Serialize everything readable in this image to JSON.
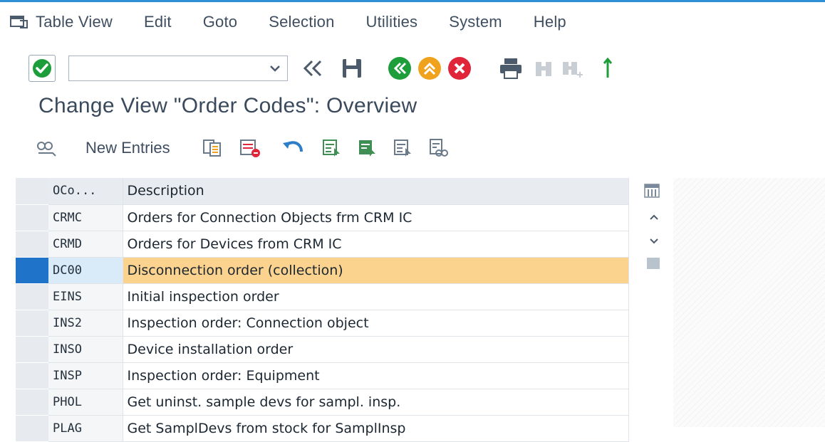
{
  "menu": {
    "items": [
      {
        "label": "Table View"
      },
      {
        "label": "Edit"
      },
      {
        "label": "Goto"
      },
      {
        "label": "Selection"
      },
      {
        "label": "Utilities"
      },
      {
        "label": "System"
      },
      {
        "label": "Help"
      }
    ]
  },
  "toolbar": {
    "command_value": "",
    "command_placeholder": ""
  },
  "page": {
    "title": "Change View \"Order Codes\": Overview"
  },
  "app_toolbar": {
    "new_entries_label": "New Entries"
  },
  "table": {
    "headers": {
      "code": "OCo...",
      "description": "Description"
    },
    "rows": [
      {
        "code": "CRMC",
        "description": "Orders for Connection Objects frm CRM IC"
      },
      {
        "code": "CRMD",
        "description": "Orders for Devices from CRM IC"
      },
      {
        "code": "DC00",
        "description": "Disconnection order (collection)",
        "selected": true
      },
      {
        "code": "EINS",
        "description": "Initial inspection order"
      },
      {
        "code": "INS2",
        "description": "Inspection order: Connection object"
      },
      {
        "code": "INSO",
        "description": "Device installation order"
      },
      {
        "code": "INSP",
        "description": "Inspection order: Equipment"
      },
      {
        "code": "PHOL",
        "description": "Get uninst. sample devs for sampl. insp."
      },
      {
        "code": "PLAG",
        "description": "Get SamplDevs from stock for SamplInsp"
      }
    ]
  },
  "colors": {
    "accent": "#2d8fd6",
    "selection_marker": "#1f73c8",
    "highlight_row": "#fbd38f",
    "ok_green": "#1e9e3a",
    "cancel_red": "#e0243a",
    "exit_orange": "#f0a21c"
  }
}
